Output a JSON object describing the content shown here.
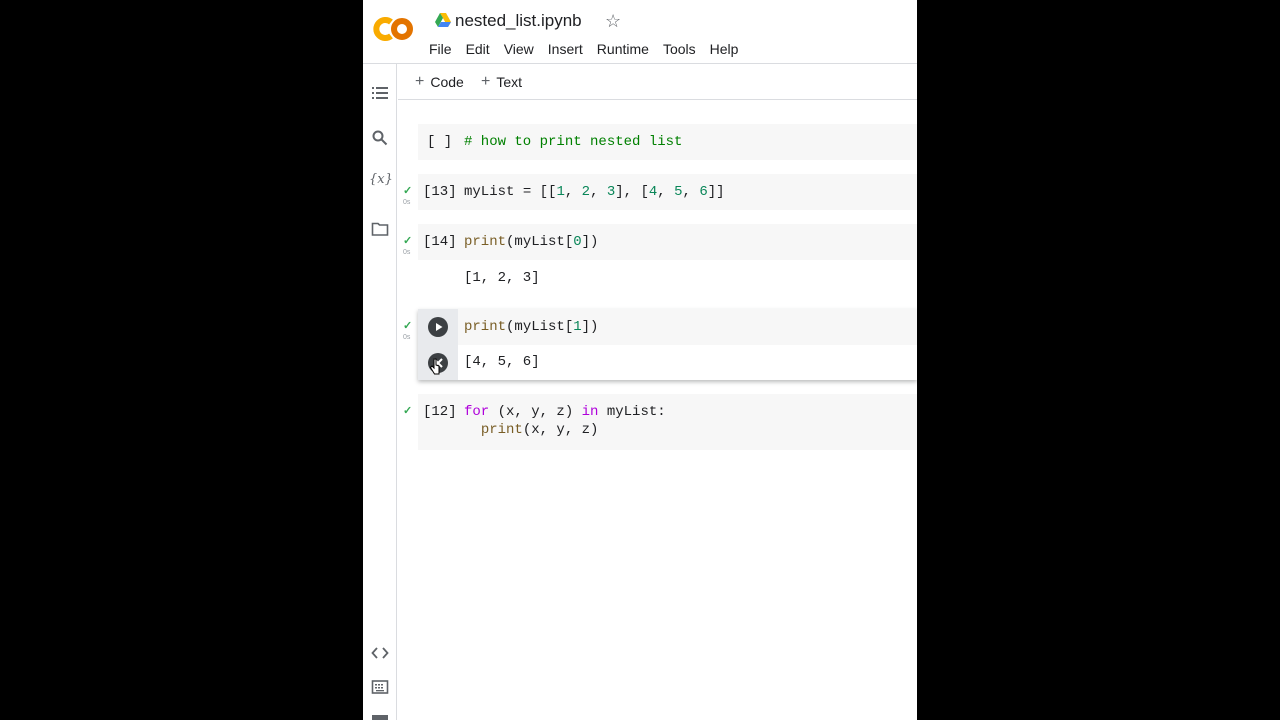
{
  "header": {
    "title": "nested_list.ipynb",
    "star_icon": "☆",
    "logo_icon": "colab-logo",
    "drive_icon": "google-drive-icon"
  },
  "menu": [
    "File",
    "Edit",
    "View",
    "Insert",
    "Runtime",
    "Tools",
    "Help"
  ],
  "toolbar": {
    "code_label": "Code",
    "text_label": "Text",
    "plus": "+"
  },
  "sidebar": {
    "icons": [
      "table-of-contents-icon",
      "search-icon",
      "variables-icon",
      "files-icon",
      "code-snippets-icon",
      "terminal-icon"
    ],
    "variables_glyph": "{x}"
  },
  "cells": [
    {
      "exec": "[ ]",
      "code": "# how to print nested list"
    },
    {
      "exec": "[13]",
      "status": "✓",
      "time": "0s",
      "code": {
        "var": "myList",
        "eq": " = [[",
        "n1": "1",
        "c1": ", ",
        "n2": "2",
        "c2": ", ",
        "n3": "3",
        "c3": "], [",
        "n4": "4",
        "c4": ", ",
        "n5": "5",
        "c5": ", ",
        "n6": "6",
        "end": "]]"
      }
    },
    {
      "exec": "[14]",
      "status": "✓",
      "time": "0s",
      "code": {
        "fn": "print",
        "open": "(myList[",
        "idx": "0",
        "close": "])"
      },
      "output": "[1, 2, 3]"
    },
    {
      "status": "✓",
      "time": "0s",
      "code": {
        "fn": "print",
        "open": "(myList[",
        "idx": "1",
        "close": "])"
      },
      "output": "[4, 5, 6]",
      "run_icon": "run-cell-icon",
      "clear_icon": "clear-output-icon"
    },
    {
      "exec": "[12]",
      "status": "✓",
      "line1": {
        "kw1": "for",
        "mid": " (x, y, z) ",
        "kw2": "in",
        "rest": " myList:"
      },
      "line2": {
        "indent": "  ",
        "fn": "print",
        "args": "(x, y, z)"
      }
    }
  ],
  "colors": {
    "keyword": "#af00db",
    "number": "#098658",
    "function": "#795e26",
    "comment": "#008000",
    "check": "#34a853"
  }
}
